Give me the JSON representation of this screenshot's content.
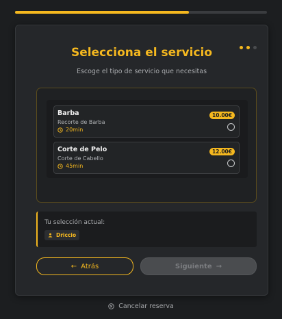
{
  "progress": {
    "fraction": 0.69
  },
  "steps": {
    "total": 3,
    "current": 2
  },
  "header": {
    "title": "Selecciona el servicio",
    "subtitle": "Escoge el tipo de servicio que necesitas"
  },
  "services": [
    {
      "name": "Barba",
      "description": "Recorte de Barba",
      "duration": "20min",
      "price": "10.00€",
      "selected": false
    },
    {
      "name": "Corte de Pelo",
      "description": "Corte de Cabello",
      "duration": "45min",
      "price": "12.00€",
      "selected": false
    }
  ],
  "selection": {
    "label": "Tu selección actual:",
    "chip": "Driccio",
    "chip_icon": "user-icon"
  },
  "buttons": {
    "back_label": "Atrás",
    "next_label": "Siguiente"
  },
  "footer": {
    "cancel_label": "Cancelar reserva"
  },
  "colors": {
    "accent": "#f5b81f",
    "background": "#1c1e20",
    "card": "#25272a"
  }
}
